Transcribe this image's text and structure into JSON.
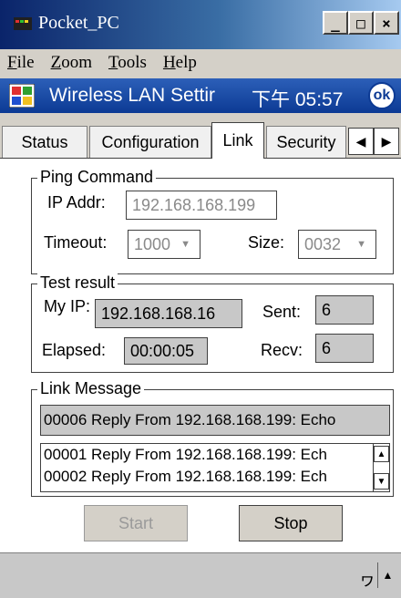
{
  "window": {
    "title": "Pocket_PC",
    "min": "_",
    "max": "□",
    "close": "×"
  },
  "menubar": [
    {
      "label": "File",
      "underline": "F",
      "rest": "ile"
    },
    {
      "label": "Zoom",
      "underline": "Z",
      "rest": "oom"
    },
    {
      "label": "Tools",
      "underline": "T",
      "rest": "ools"
    },
    {
      "label": "Help",
      "underline": "H",
      "rest": "elp"
    }
  ],
  "device": {
    "app_title": "Wireless LAN Settir",
    "clock": "下午 05:57",
    "ok": "ok"
  },
  "tabs": [
    "Status",
    "Configuration",
    "Link",
    "Security"
  ],
  "active_tab": "Link",
  "ping": {
    "title": "Ping Command",
    "ip_label": "IP Addr:",
    "ip_value": "192.168.168.199",
    "timeout_label": "Timeout:",
    "timeout_value": "1000",
    "size_label": "Size:",
    "size_value": "0032"
  },
  "test": {
    "title": "Test result",
    "myip_label": "My IP:",
    "myip_value": "192.168.168.16",
    "sent_label": "Sent:",
    "sent_value": "6",
    "elapsed_label": "Elapsed:",
    "elapsed_value": "00:00:05",
    "recv_label": "Recv:",
    "recv_value": "6"
  },
  "link": {
    "title": "Link Message",
    "latest": "00006 Reply From 192.168.168.199: Echo",
    "lines": [
      "00001 Reply From 192.168.168.199: Ech",
      "00002 Reply From 192.168.168.199: Ech"
    ]
  },
  "buttons": {
    "start": "Start",
    "stop": "Stop"
  },
  "sip_glyph": "ヮ"
}
